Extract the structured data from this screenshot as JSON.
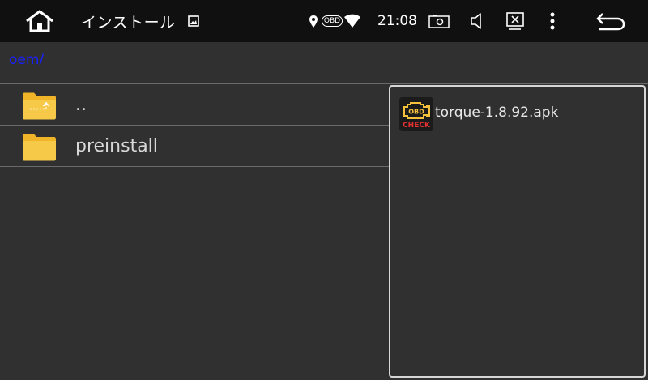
{
  "status_bar": {
    "title": "インストール",
    "obd_badge": "OBD",
    "time": "21:08",
    "icons": {
      "home": "home-icon",
      "gallery": "gallery-icon",
      "location": "location-icon",
      "wifi": "wifi-icon",
      "screenshot": "screenshot-icon",
      "volume": "volume-icon",
      "close": "close-window-icon",
      "menu": "more-vert-icon",
      "back": "back-arrow-icon"
    }
  },
  "path": "oem/",
  "files": [
    {
      "name": "..",
      "icon": "parent-folder-icon"
    },
    {
      "name": "preinstall",
      "icon": "folder-icon"
    }
  ],
  "panel": {
    "items": [
      {
        "name": "torque-1.8.92.apk",
        "icon": "obd-check-icon",
        "icon_text_top": "OBD",
        "icon_text_bottom": "CHECK"
      }
    ]
  },
  "colors": {
    "background": "#303030",
    "status_bar": "#101010",
    "path_text": "#1a20ff",
    "folder": "#f5c13c",
    "divider": "#6a6a6a",
    "panel_border": "#d6d6d6"
  }
}
